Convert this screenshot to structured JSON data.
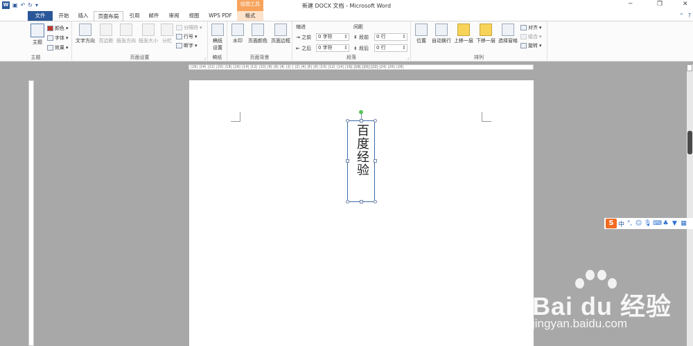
{
  "app": {
    "title": "新建 DOCX 文档 - Microsoft Word",
    "logo_letter": "W",
    "contextual_group": "绘图工具"
  },
  "tabs": [
    {
      "label": "文件"
    },
    {
      "label": "开始"
    },
    {
      "label": "插入"
    },
    {
      "label": "页面布局"
    },
    {
      "label": "引用"
    },
    {
      "label": "邮件"
    },
    {
      "label": "审阅"
    },
    {
      "label": "视图"
    },
    {
      "label": "WPS PDF"
    },
    {
      "label": "格式"
    }
  ],
  "ribbon": {
    "theme": {
      "group": "主题",
      "theme_btn": "主题",
      "colors": "颜色",
      "fonts": "字体",
      "effects": "效果"
    },
    "page_setup": {
      "group": "页面设置",
      "text_direction": "文字方向",
      "margins": "页边距",
      "orientation": "纸张方向",
      "size": "纸张大小",
      "columns": "分栏",
      "breaks": "分隔符",
      "line_numbers": "行号",
      "hyphenation": "断字"
    },
    "manuscript": {
      "group": "稿纸",
      "btn_line1": "稿纸",
      "btn_line2": "设置"
    },
    "page_background": {
      "group": "页面背景",
      "watermark": "水印",
      "page_color": "页面颜色",
      "page_borders": "页面边框"
    },
    "paragraph": {
      "group": "段落",
      "indent_label": "缩进",
      "spacing_label": "间距",
      "indent_before_label": "之前",
      "indent_before_value": "0 字符",
      "indent_after_label": "之后",
      "indent_after_value": "0 字符",
      "spacing_before_label": "段前",
      "spacing_before_value": "0 行",
      "spacing_after_label": "段后",
      "spacing_after_value": "0 行"
    },
    "arrange": {
      "group": "排列",
      "position": "位置",
      "wrap_text": "自动换行",
      "bring_forward": "上移一层",
      "send_backward": "下移一层",
      "selection_pane": "选择窗格",
      "align": "对齐",
      "group_btn": "组合",
      "rotate": "旋转"
    }
  },
  "ruler": {
    "ticks": "|26| |24| |22| |20| |18| |16| |14| |12| |10| |8| |6| |4| |2| | |2| |4| |6| |8| |10| |12| |14| |16| |18| |20| |22| |24| |26| |28|"
  },
  "document": {
    "textbox_text": "百度经验"
  },
  "ime": {
    "label": "中"
  },
  "watermark": {
    "brand": "Bai du 经验",
    "url": "jingyan.baidu.com"
  }
}
